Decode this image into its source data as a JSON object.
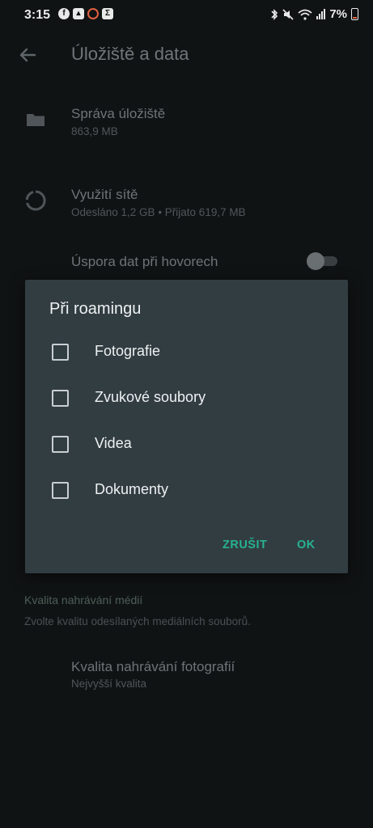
{
  "status_bar": {
    "time": "3:15",
    "battery": "7%",
    "left_icons": [
      "facebook-icon",
      "gallery-icon",
      "opera-icon",
      "sigma-icon"
    ],
    "right_icons": [
      "bluetooth-icon",
      "mute-icon",
      "wifi-icon",
      "signal-icon",
      "battery-icon"
    ]
  },
  "app_bar": {
    "title": "Úložiště a data"
  },
  "settings": {
    "storage": {
      "title": "Správa úložiště",
      "subtitle": "863,9 MB",
      "icon": "folder-icon"
    },
    "network": {
      "title": "Využití sítě",
      "subtitle": "Odesláno 1,2 GB • Přijato 619,7 MB",
      "icon": "data-usage-icon"
    },
    "data_saver": {
      "title": "Úspora dat při hovorech",
      "enabled": false
    },
    "media_quality_section": {
      "title": "Kvalita nahrávání médií",
      "subtitle": "Zvolte kvalitu odesílaných mediálních souborů."
    },
    "photo_quality": {
      "title": "Kvalita nahrávání fotografií",
      "subtitle": "Nejvyšší kvalita"
    }
  },
  "dialog": {
    "title": "Při roamingu",
    "options": [
      {
        "label": "Fotografie",
        "checked": false
      },
      {
        "label": "Zvukové soubory",
        "checked": false
      },
      {
        "label": "Videa",
        "checked": false
      },
      {
        "label": "Dokumenty",
        "checked": false
      }
    ],
    "cancel_label": "ZRUŠIT",
    "ok_label": "OK"
  },
  "colors": {
    "accent": "#27b290",
    "dialog_bg": "#323d42",
    "screen_bg": "#101314"
  }
}
